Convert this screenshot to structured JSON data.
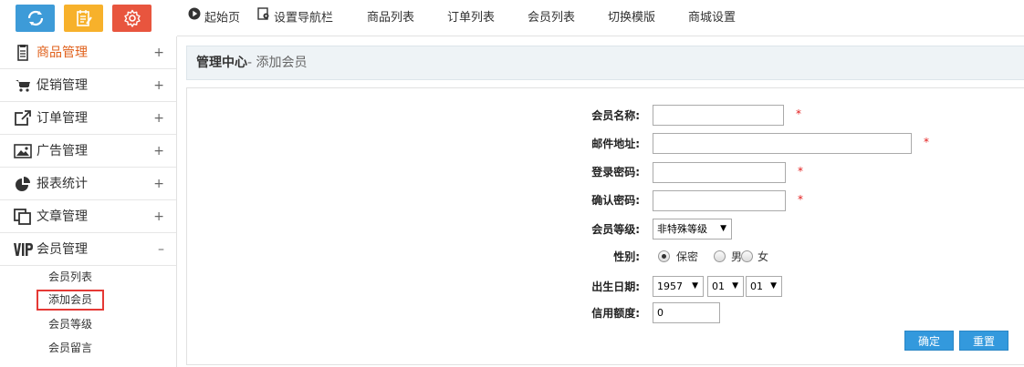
{
  "topbar": {
    "icon_buttons": [
      {
        "icon": "refresh-icon",
        "color": "#3d9bd8"
      },
      {
        "icon": "edit-note-icon",
        "color": "#f7b12b"
      },
      {
        "icon": "gear-icon",
        "color": "#e8553e"
      }
    ],
    "nav": {
      "home": "起始页",
      "set_nav": "设置导航栏",
      "goods_list": "商品列表",
      "order_list": "订单列表",
      "member_list": "会员列表",
      "switch_template": "切换模版",
      "mall_settings": "商城设置"
    }
  },
  "sidebar": {
    "items": [
      {
        "label": "商品管理",
        "toggle": "+",
        "icon": "clipboard-icon"
      },
      {
        "label": "促销管理",
        "toggle": "+",
        "icon": "cart-icon"
      },
      {
        "label": "订单管理",
        "toggle": "+",
        "icon": "external-link-icon"
      },
      {
        "label": "广告管理",
        "toggle": "+",
        "icon": "image-icon"
      },
      {
        "label": "报表统计",
        "toggle": "+",
        "icon": "pie-chart-icon"
      },
      {
        "label": "文章管理",
        "toggle": "+",
        "icon": "copy-icon"
      },
      {
        "label": "会员管理",
        "toggle": "–",
        "icon": "vip-icon"
      }
    ],
    "submenu": [
      "会员列表",
      "添加会员",
      "会员等级",
      "会员留言"
    ],
    "active_color": "#e0601b"
  },
  "main": {
    "breadcrumb_title": "管理中心",
    "breadcrumb_sub": "- 添加会员"
  },
  "form": {
    "username_label": "会员名称:",
    "email_label": "邮件地址:",
    "password_label": "登录密码:",
    "confirm_label": "确认密码:",
    "rank_label": "会员等级:",
    "gender_label": "性别:",
    "birthday_label": "出生日期:",
    "credit_label": "信用额度:",
    "required_mark": "*",
    "rank_value": "非特殊等级",
    "gender_options": [
      "保密",
      "男",
      "女"
    ],
    "gender_selected": "保密",
    "birth_year": "1957",
    "birth_month": "01",
    "birth_day": "01",
    "credit_value": "0",
    "submit_label": "确定",
    "reset_label": "重置"
  }
}
